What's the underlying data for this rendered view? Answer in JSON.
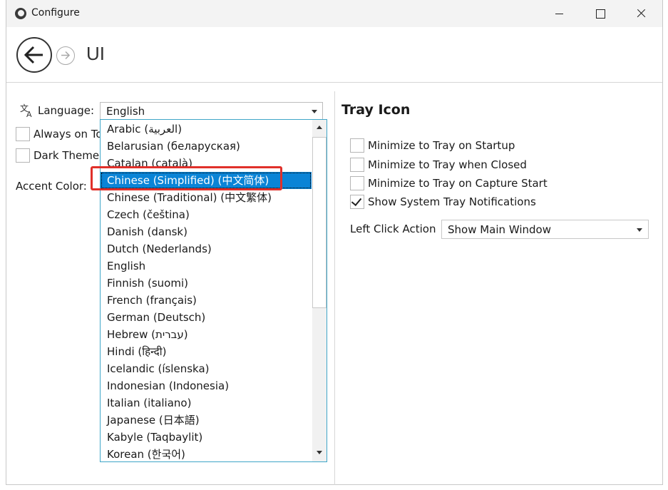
{
  "window": {
    "title": "Configure"
  },
  "header": {
    "title": "UI"
  },
  "language": {
    "label": "Language:",
    "selected": "English",
    "options": [
      "Arabic (العربية)",
      "Belarusian (беларуская)",
      "Catalan (català)",
      "Chinese (Simplified) (中文简体)",
      "Chinese (Traditional) (中文繁体)",
      "Czech (čeština)",
      "Danish (dansk)",
      "Dutch (Nederlands)",
      "English",
      "Finnish (suomi)",
      "French (français)",
      "German (Deutsch)",
      "Hebrew (עברית)",
      "Hindi (हिन्दी)",
      "Icelandic (íslenska)",
      "Indonesian (Indonesia)",
      "Italian (italiano)",
      "Japanese (日本語)",
      "Kabyle (Taqbaylit)",
      "Korean (한국어)"
    ],
    "highlighted": "Chinese (Simplified) (中文简体)"
  },
  "general": {
    "always_on_top": "Always on Top",
    "dark_theme": "Dark Theme",
    "accent_color": "Accent Color:"
  },
  "tray": {
    "title": "Tray Icon",
    "options": [
      {
        "label": "Minimize to Tray on Startup",
        "checked": false
      },
      {
        "label": "Minimize to Tray when Closed",
        "checked": false
      },
      {
        "label": "Minimize to Tray on Capture Start",
        "checked": false
      },
      {
        "label": "Show System Tray Notifications",
        "checked": true
      }
    ],
    "left_click_label": "Left Click Action",
    "left_click_value": "Show Main Window"
  },
  "colors": {
    "selection": "#0a84d6",
    "dropdown_border": "#3fa6c8",
    "annotation": "#e0302a"
  }
}
